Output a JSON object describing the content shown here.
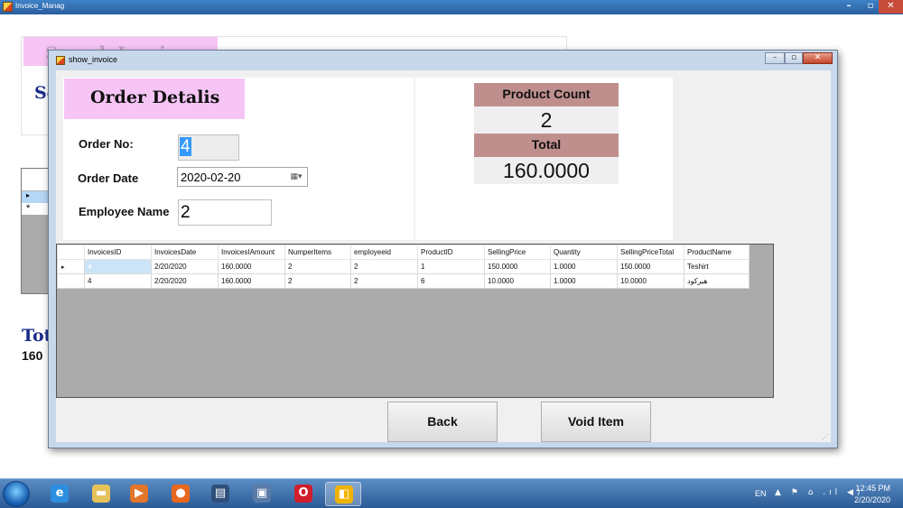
{
  "main_window": {
    "title": "Invoice_Manag",
    "controls": {
      "minimize": "–",
      "maximize": "▫",
      "close": "✕"
    },
    "header_text": "Search Invoice",
    "subtitle_fragment": "Se",
    "grid_current_row_marker": "▸",
    "grid_new_row_marker": "*",
    "total_label": "Tot",
    "total_value": "160"
  },
  "dialog": {
    "title": "show_invoice",
    "controls": {
      "minimize": "–",
      "maximize": "▫",
      "close": "✕"
    },
    "heading": "Order Detalis",
    "labels": {
      "order_no": "Order No:",
      "order_date": "Order Date",
      "employee_name": "Employee Name"
    },
    "fields": {
      "order_no": "4",
      "order_date": "2020-02-20",
      "employee_name": "2"
    },
    "stats": {
      "product_count_label": "Product Count",
      "product_count_value": "2",
      "total_label": "Total",
      "total_value": "160.0000"
    },
    "grid": {
      "columns": [
        "InvoicesID",
        "InvoicesDate",
        "InvoicesIAmount",
        "NumperItems",
        "employeeid",
        "ProductID",
        "SellingPrice",
        "Quantity",
        "SellingPriceTotal",
        "ProductName"
      ],
      "current_row_marker": "▸",
      "rows": [
        [
          "4",
          "2/20/2020",
          "160.0000",
          "2",
          "2",
          "1",
          "150.0000",
          "1.0000",
          "150.0000",
          "Teshirt"
        ],
        [
          "4",
          "2/20/2020",
          "160.0000",
          "2",
          "2",
          "6",
          "10.0000",
          "1.0000",
          "10.0000",
          "هيركود"
        ]
      ]
    },
    "buttons": {
      "back": "Back",
      "void_item": "Void Item"
    }
  },
  "taskbar": {
    "apps": [
      {
        "icon": "internet-explorer-icon",
        "glyph": "e",
        "color": "#2d8fe0"
      },
      {
        "icon": "file-explorer-icon",
        "glyph": "▬",
        "color": "#e6c25a"
      },
      {
        "icon": "media-player-icon",
        "glyph": "▶",
        "color": "#e2762a"
      },
      {
        "icon": "firefox-icon",
        "glyph": "●",
        "color": "#e8671c"
      },
      {
        "icon": "document-app-icon",
        "glyph": "▤",
        "color": "#2f4f7a"
      },
      {
        "icon": "computer-app-icon",
        "glyph": "▣",
        "color": "#5a7ba8"
      },
      {
        "icon": "opera-icon",
        "glyph": "O",
        "color": "#d11e2d"
      },
      {
        "icon": "invoice-app-icon",
        "glyph": "◧",
        "color": "#f0b400"
      }
    ],
    "language": "EN",
    "tray_icons": [
      "▲",
      "⚑",
      "⌂",
      ".ıl",
      "◀)"
    ],
    "time": "12:45 PM",
    "date": "2/20/2020"
  }
}
